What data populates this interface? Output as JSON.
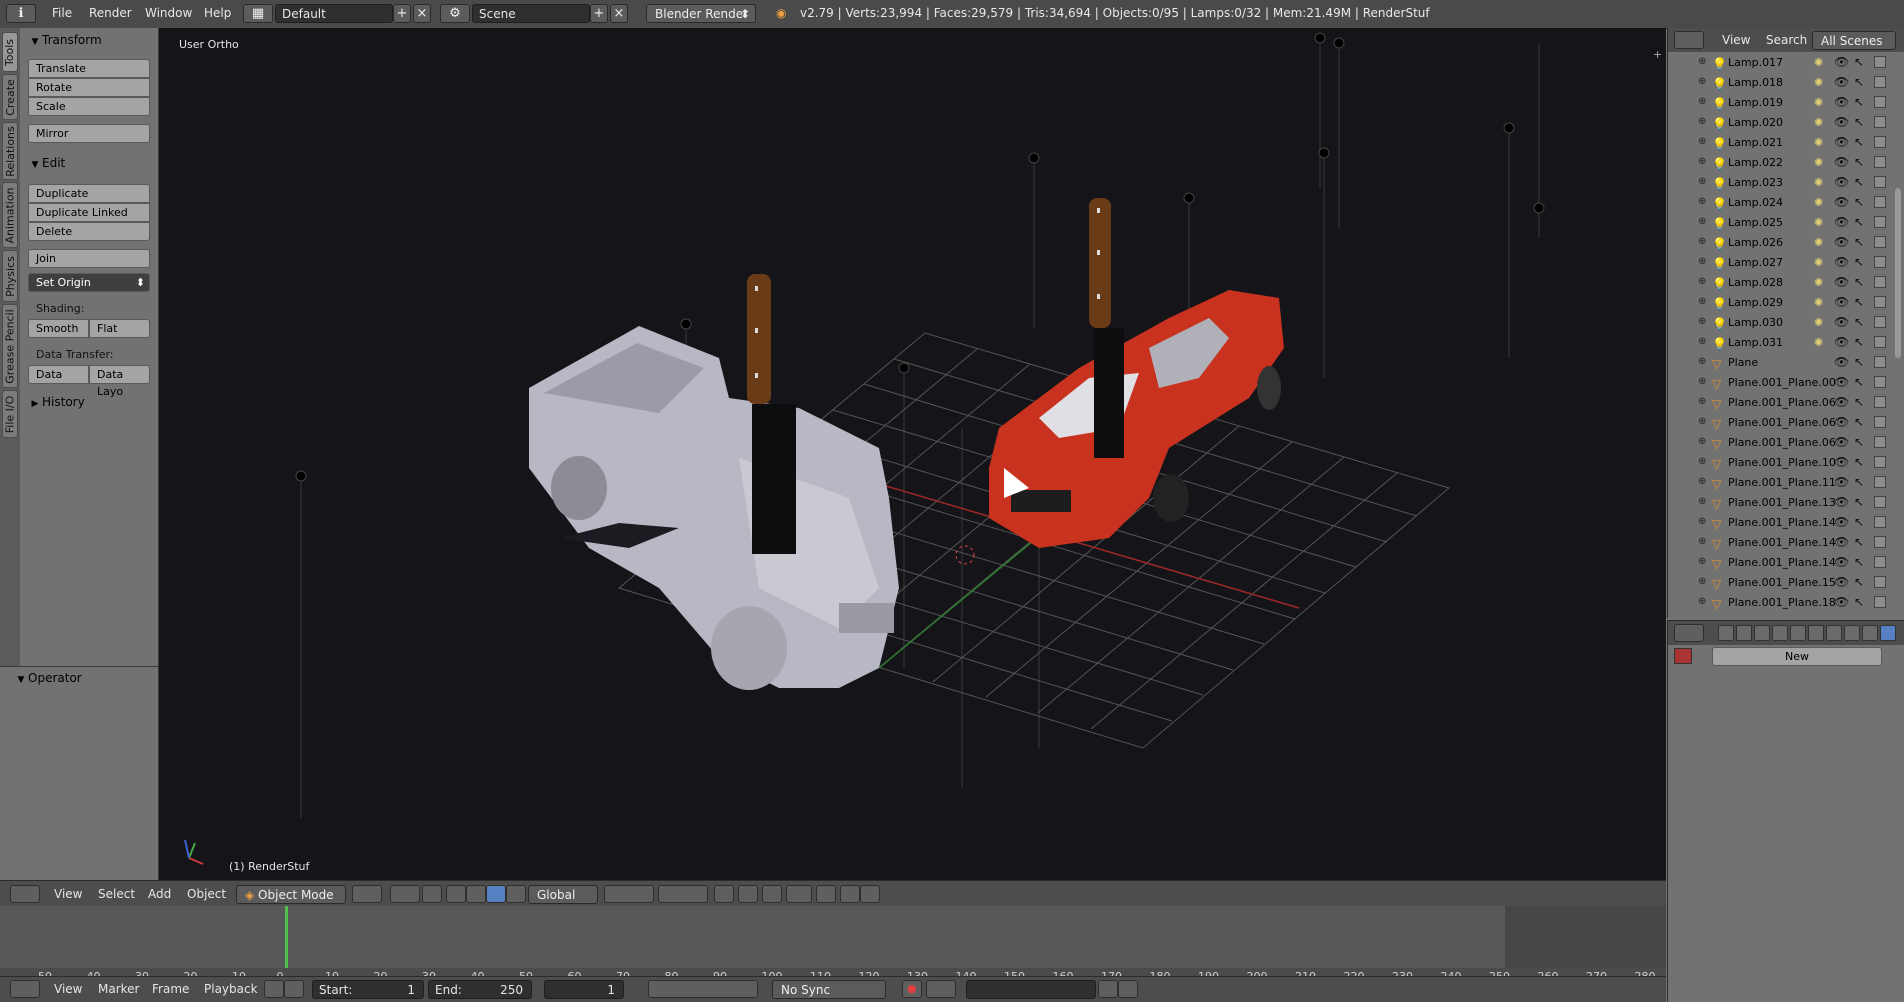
{
  "topbar": {
    "menu": [
      "File",
      "Render",
      "Window",
      "Help"
    ],
    "screen_layout": "Default",
    "scene": "Scene",
    "render_engine": "Blender Render",
    "stats": "v2.79 | Verts:23,994 | Faces:29,579 | Tris:34,694 | Objects:0/95 | Lamps:0/32 | Mem:21.49M | RenderStuf"
  },
  "vtabs": [
    "Tools",
    "Create",
    "Relations",
    "Animation",
    "Physics",
    "Grease Pencil",
    "File I/O"
  ],
  "shelf": {
    "transform_title": "Transform",
    "translate": "Translate",
    "rotate": "Rotate",
    "scale": "Scale",
    "mirror": "Mirror",
    "edit_title": "Edit",
    "duplicate": "Duplicate",
    "duplicate_linked": "Duplicate Linked",
    "delete": "Delete",
    "join": "Join",
    "set_origin": "Set Origin",
    "shading_label": "Shading:",
    "smooth": "Smooth",
    "flat": "Flat",
    "data_transfer_label": "Data Transfer:",
    "data": "Data",
    "data_layout": "Data Layo",
    "history_title": "History",
    "operator_title": "Operator"
  },
  "viewport": {
    "view_label": "User Ortho",
    "object_label": "(1) RenderStuf"
  },
  "vp_header": {
    "menu": [
      "View",
      "Select",
      "Add",
      "Object"
    ],
    "mode": "Object Mode",
    "orientation": "Global"
  },
  "timeline": {
    "ticks": [
      "-50",
      "-40",
      "-30",
      "-20",
      "-10",
      "0",
      "10",
      "20",
      "30",
      "40",
      "50",
      "60",
      "70",
      "80",
      "90",
      "100",
      "110",
      "120",
      "130",
      "140",
      "150",
      "160",
      "170",
      "180",
      "190",
      "200",
      "210",
      "220",
      "230",
      "240",
      "250",
      "260",
      "270",
      "280"
    ],
    "current_frame": 0
  },
  "tl_header": {
    "menu": [
      "View",
      "Marker",
      "Frame",
      "Playback"
    ],
    "start": "Start:",
    "start_value": "1",
    "end": "End:",
    "end_value": "250",
    "frame_value": "1",
    "sync": "No Sync"
  },
  "outliner": {
    "header": [
      "View",
      "Search",
      "All Scenes"
    ],
    "rows": [
      {
        "name": "Lamp.017",
        "type": "lamp"
      },
      {
        "name": "Lamp.018",
        "type": "lamp"
      },
      {
        "name": "Lamp.019",
        "type": "lamp"
      },
      {
        "name": "Lamp.020",
        "type": "lamp"
      },
      {
        "name": "Lamp.021",
        "type": "lamp"
      },
      {
        "name": "Lamp.022",
        "type": "lamp"
      },
      {
        "name": "Lamp.023",
        "type": "lamp"
      },
      {
        "name": "Lamp.024",
        "type": "lamp"
      },
      {
        "name": "Lamp.025",
        "type": "lamp"
      },
      {
        "name": "Lamp.026",
        "type": "lamp"
      },
      {
        "name": "Lamp.027",
        "type": "lamp"
      },
      {
        "name": "Lamp.028",
        "type": "lamp"
      },
      {
        "name": "Lamp.029",
        "type": "lamp"
      },
      {
        "name": "Lamp.030",
        "type": "lamp"
      },
      {
        "name": "Lamp.031",
        "type": "lamp"
      },
      {
        "name": "Plane",
        "type": "mesh"
      },
      {
        "name": "Plane.001_Plane.00",
        "type": "mesh"
      },
      {
        "name": "Plane.001_Plane.06",
        "type": "mesh"
      },
      {
        "name": "Plane.001_Plane.06",
        "type": "mesh"
      },
      {
        "name": "Plane.001_Plane.06",
        "type": "mesh"
      },
      {
        "name": "Plane.001_Plane.10",
        "type": "mesh"
      },
      {
        "name": "Plane.001_Plane.11",
        "type": "mesh"
      },
      {
        "name": "Plane.001_Plane.13",
        "type": "mesh"
      },
      {
        "name": "Plane.001_Plane.14",
        "type": "mesh"
      },
      {
        "name": "Plane.001_Plane.14",
        "type": "mesh"
      },
      {
        "name": "Plane.001_Plane.14",
        "type": "mesh"
      },
      {
        "name": "Plane.001_Plane.15",
        "type": "mesh"
      },
      {
        "name": "Plane.001_Plane.18",
        "type": "mesh"
      }
    ]
  },
  "props": {
    "new_button": "New"
  }
}
